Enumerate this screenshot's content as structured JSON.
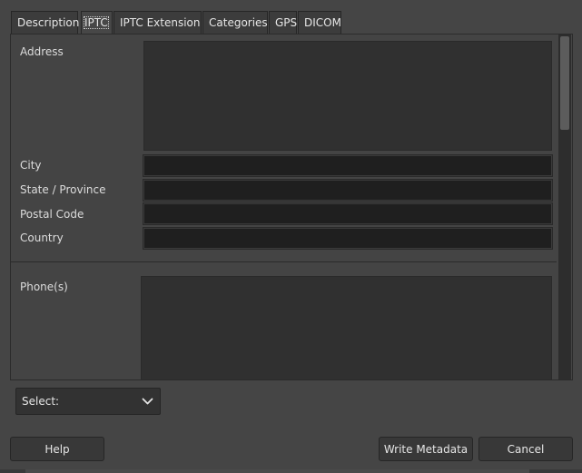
{
  "tabs": [
    {
      "label": "Description"
    },
    {
      "label": "IPTC"
    },
    {
      "label": "IPTC Extension"
    },
    {
      "label": "Categories"
    },
    {
      "label": "GPS"
    },
    {
      "label": "DICOM"
    }
  ],
  "active_tab": "IPTC",
  "fields": {
    "address": {
      "label": "Address",
      "value": ""
    },
    "city": {
      "label": "City",
      "value": ""
    },
    "state": {
      "label": "State / Province",
      "value": ""
    },
    "postal": {
      "label": "Postal Code",
      "value": ""
    },
    "country": {
      "label": "Country",
      "value": ""
    },
    "phones": {
      "label": "Phone(s)",
      "value": ""
    }
  },
  "select": {
    "label": "Select:"
  },
  "buttons": {
    "help": "Help",
    "write": "Write Metadata",
    "cancel": "Cancel"
  },
  "colors": {
    "window_bg": "#454545",
    "input_bg": "#1f1f1f",
    "textarea_bg": "#303030"
  }
}
